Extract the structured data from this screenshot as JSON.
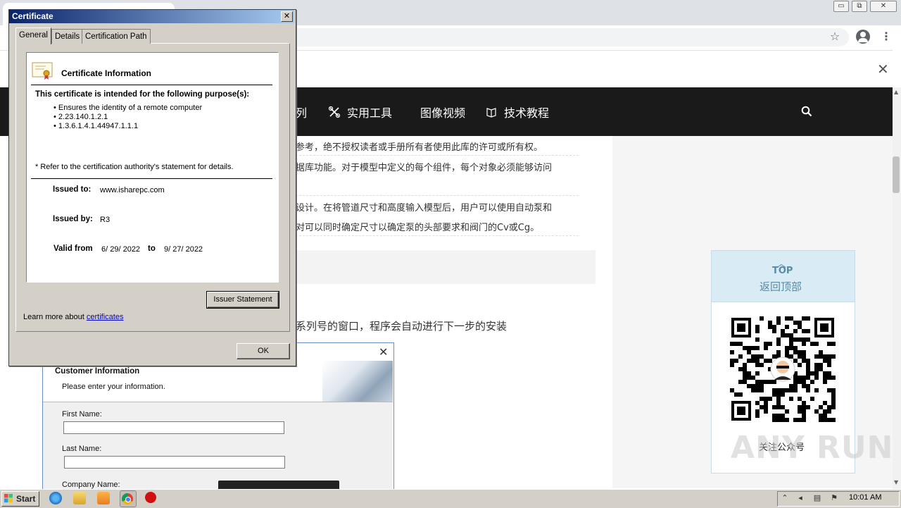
{
  "browser": {
    "window_controls": [
      "▭",
      "⧉",
      "✕"
    ],
    "infobar_close": "✕"
  },
  "site": {
    "nav": [
      {
        "label": "列",
        "icon": ""
      },
      {
        "label": "实用工具",
        "icon": "tools-icon"
      },
      {
        "label": "图像视频",
        "icon": ""
      },
      {
        "label": "技术教程",
        "icon": "book-icon"
      }
    ],
    "content_lines": [
      "参考，绝不授权读者或手册所有者使用此库的许可或所有权。",
      "据库功能。对于模型中定义的每个组件，每个对象必须能够访问",
      "设计。在将管道尺寸和高度输入模型后，用户可以使用自动泵和",
      "对可以同时确定尺寸以确定泵的头部要求和阀门的Cv或Cg。"
    ],
    "install_line": "系列号的窗口，程序会自动进行下一步的安装",
    "top_widget": {
      "arrow": "︿",
      "label": "TOP",
      "back": "返回顶部"
    },
    "qr_caption": "关注公众号",
    "watermark": "ANY RUN"
  },
  "installer": {
    "close": "✕",
    "heading": "Customer Information",
    "subheading": "Please enter your information.",
    "first_name_label": "First Name:",
    "last_name_label": "Last Name:",
    "company_label": "Company Name:"
  },
  "certificate": {
    "title": "Certificate",
    "close": "✕",
    "tabs": [
      "General",
      "Details",
      "Certification Path"
    ],
    "info_title": "Certificate Information",
    "purpose_heading": "This certificate is intended for the following purpose(s):",
    "purposes": [
      "• Ensures the identity of a remote computer",
      "• 2.23.140.1.2.1",
      "• 1.3.6.1.4.1.44947.1.1.1"
    ],
    "refer_note": "* Refer to the certification authority's statement for details.",
    "issued_to_label": "Issued to:",
    "issued_to": "www.isharepc.com",
    "issued_by_label": "Issued by:",
    "issued_by": "R3",
    "valid_from_label": "Valid from",
    "valid_from": "6/ 29/ 2022",
    "to_label": "to",
    "valid_to": "9/ 27/ 2022",
    "issuer_button": "Issuer Statement",
    "learn_more_prefix": "Learn more about ",
    "learn_more_link": "certificates",
    "ok_button": "OK"
  },
  "taskbar": {
    "start": "Start",
    "clock": "10:01 AM"
  }
}
